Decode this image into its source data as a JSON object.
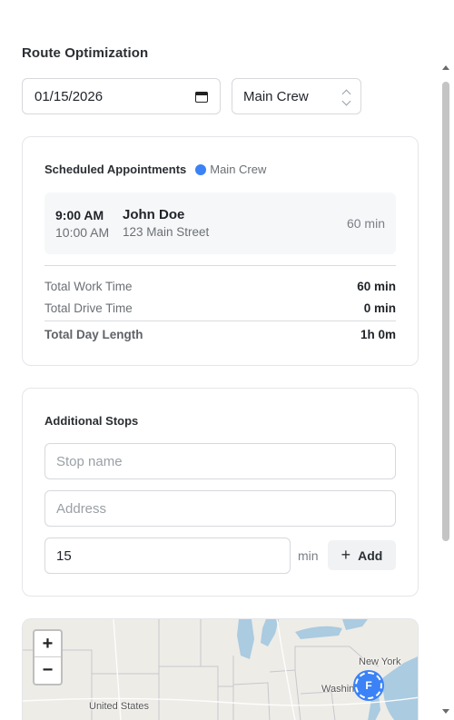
{
  "page": {
    "title": "Route Optimization"
  },
  "controls": {
    "date_value": "01/15/2026",
    "crew_selected": "Main Crew"
  },
  "appointments": {
    "title": "Scheduled Appointments",
    "crew_tag": "Main Crew",
    "crew_color": "#3b82f6",
    "items": [
      {
        "start": "9:00 AM",
        "end": "10:00 AM",
        "name": "John Doe",
        "address": "123 Main Street",
        "duration": "60 min"
      }
    ],
    "summary": {
      "work_label": "Total Work Time",
      "work_value": "60 min",
      "drive_label": "Total Drive Time",
      "drive_value": "0 min",
      "day_label": "Total Day Length",
      "day_value": "1h 0m"
    }
  },
  "stops": {
    "title": "Additional Stops",
    "name_placeholder": "Stop name",
    "address_placeholder": "Address",
    "duration_value": "15",
    "duration_unit": "min",
    "add_label": "Add",
    "add_icon": "plus-icon"
  },
  "map": {
    "zoom_in": "+",
    "zoom_out": "−",
    "labels": {
      "new_york": "New York",
      "washington": "Washin",
      "country": "United States"
    },
    "marker_label": "F",
    "marker_color": "#3b82f6"
  }
}
